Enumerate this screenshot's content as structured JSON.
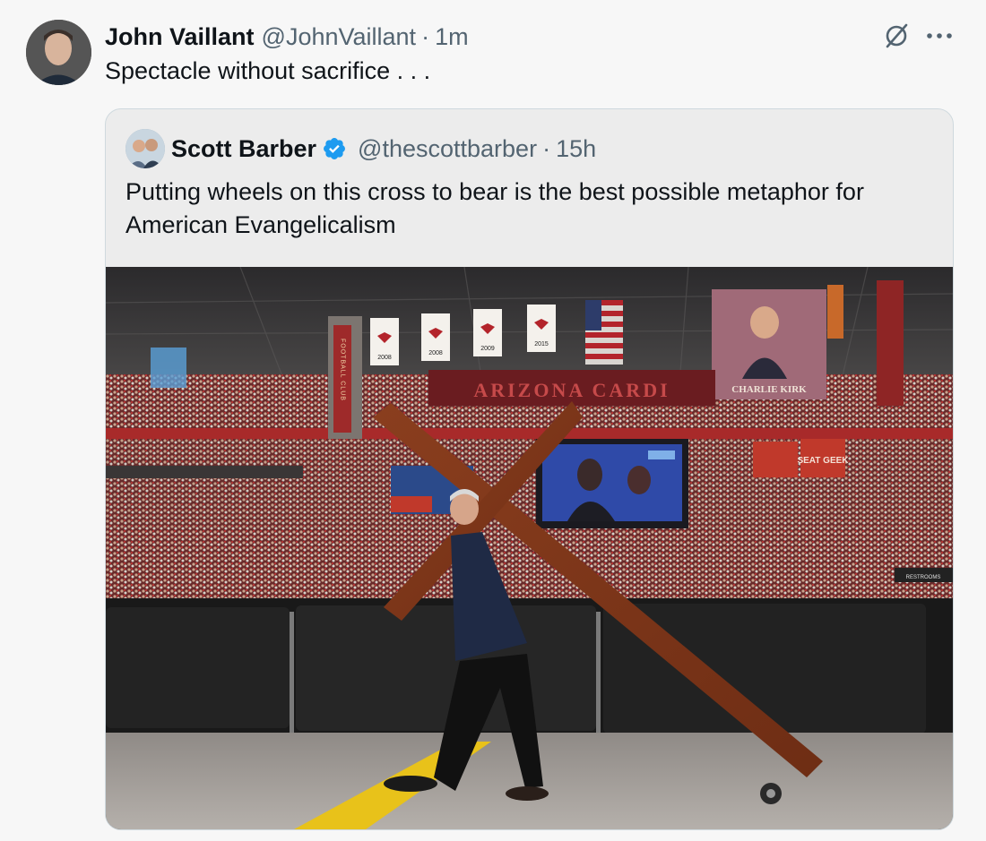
{
  "tweet": {
    "author_name": "John Vaillant",
    "author_handle": "@JohnVaillant",
    "separator": "·",
    "time": "1m",
    "text": "Spectacle without sacrifice . . ."
  },
  "quote": {
    "author_name": "Scott Barber",
    "author_handle": "@thescottbarber",
    "separator": "·",
    "time": "15h",
    "text": "Putting wheels on this cross to bear is the best possible metaphor for American Evangelicalism",
    "verified": true
  },
  "media": {
    "arena_sign": "ARIZONA  CARDI",
    "banner_name": "CHARLIE KIRK",
    "years": [
      "2008",
      "2008",
      "2009",
      "2015"
    ],
    "football_club": "FOOTBALL CLUB",
    "seat_geek": "SEAT GEEK",
    "restrooms": "RESTROOMS"
  },
  "icons": {
    "grok": "grok-icon",
    "more": "more-icon",
    "verified": "verified-badge-icon"
  },
  "colors": {
    "verified_blue": "#1d9bf0",
    "text_primary": "#0f1419",
    "text_secondary": "#536471",
    "cardinals_red": "#b3242b"
  }
}
